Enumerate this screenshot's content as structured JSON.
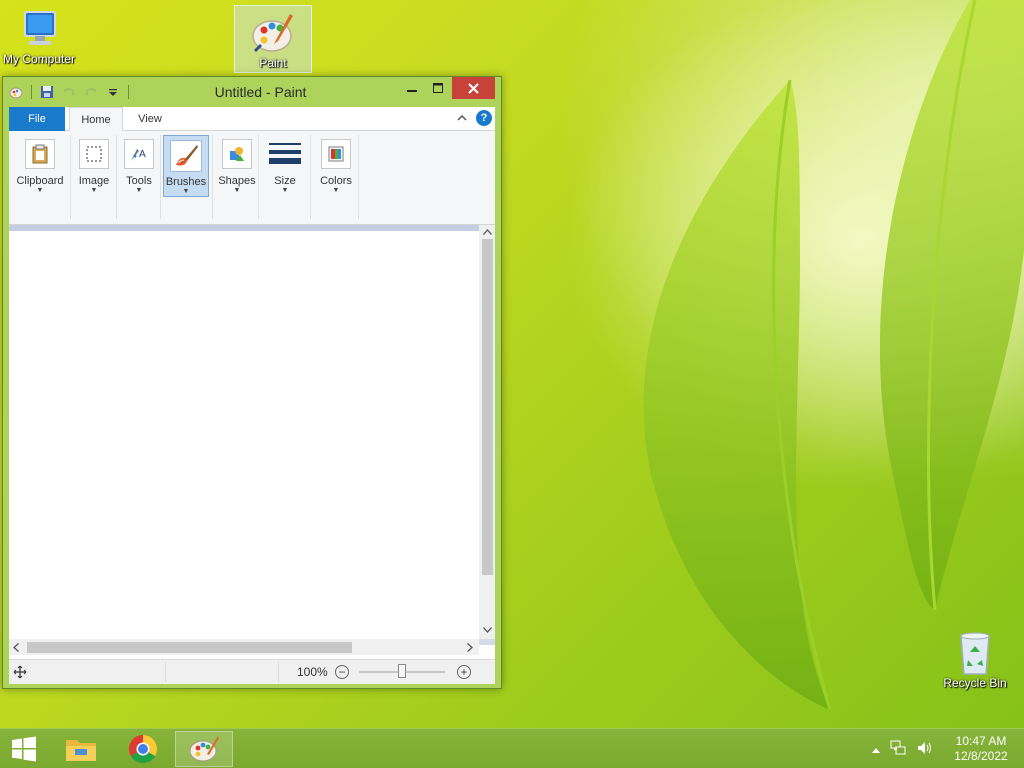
{
  "desktop": {
    "icons": [
      {
        "label": "My Computer",
        "icon": "computer-icon"
      },
      {
        "label": "Paint",
        "icon": "paint-icon"
      },
      {
        "label": "Recycle Bin",
        "icon": "recycle-bin-icon"
      }
    ]
  },
  "window": {
    "title": "Untitled - Paint",
    "quick_access": [
      "paint-app-icon",
      "save-icon",
      "undo-icon",
      "redo-icon",
      "customize-dropdown-icon"
    ],
    "controls": {
      "minimize": "minimize-icon",
      "maximize": "maximize-icon",
      "close": "close-icon"
    }
  },
  "ribbon": {
    "tabs": [
      {
        "label": "File"
      },
      {
        "label": "Home"
      },
      {
        "label": "View"
      }
    ],
    "help_label": "?",
    "active_tab": "Home",
    "groups": [
      {
        "label": "Clipboard",
        "icon": "clipboard-icon"
      },
      {
        "label": "Image",
        "icon": "select-icon"
      },
      {
        "label": "Tools",
        "icon": "tools-icon"
      },
      {
        "label": "Brushes",
        "icon": "brush-icon"
      },
      {
        "label": "Shapes",
        "icon": "shapes-icon"
      },
      {
        "label": "Size",
        "icon": "size-icon"
      },
      {
        "label": "Colors",
        "icon": "colors-icon"
      }
    ],
    "active_group": "Brushes"
  },
  "statusbar": {
    "zoom": "100%",
    "zoom_level_percent": 100
  },
  "taskbar": {
    "items": [
      "windows-start-icon",
      "file-explorer-icon",
      "chrome-icon",
      "paint-icon"
    ],
    "clock": {
      "time": "10:47 AM",
      "date": "12/8/2022"
    }
  },
  "colors": {
    "title_green": "#aed35a",
    "file_tab_blue": "#1979ca",
    "close_red": "#c7433a",
    "active_button": "#c5dcf3"
  }
}
